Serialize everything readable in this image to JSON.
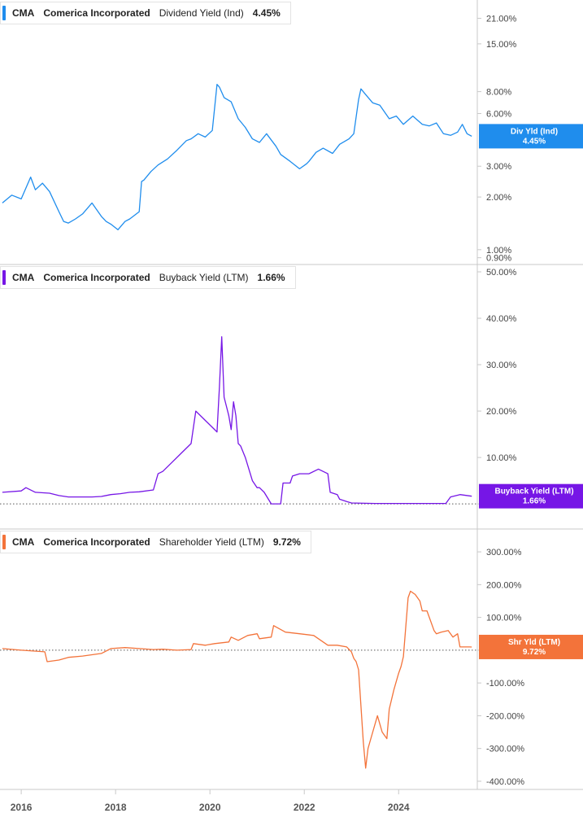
{
  "chart_data": [
    {
      "type": "line",
      "ticker": "CMA",
      "company": "Comerica Incorporated",
      "metric": "Dividend Yield (Ind)",
      "value_label": "4.45%",
      "badge_title": "Div Yld (Ind)",
      "badge_value": "4.45%",
      "color": "#1f8ded",
      "yscale": "log",
      "ylim": [
        0.85,
        24
      ],
      "ytick_values": [
        21,
        15,
        8,
        6,
        3,
        2,
        1,
        0.9
      ],
      "ytick_labels": [
        "21.00%",
        "15.00%",
        "8.00%",
        "6.00%",
        "3.00%",
        "2.00%",
        "1.00%",
        "0.90%"
      ],
      "x": [
        2015.6,
        2015.8,
        2016.0,
        2016.2,
        2016.3,
        2016.45,
        2016.6,
        2016.8,
        2016.9,
        2017.0,
        2017.15,
        2017.3,
        2017.5,
        2017.7,
        2017.8,
        2017.9,
        2018.05,
        2018.2,
        2018.3,
        2018.5,
        2018.55,
        2018.6,
        2018.75,
        2018.9,
        2019.1,
        2019.3,
        2019.5,
        2019.6,
        2019.75,
        2019.9,
        2020.05,
        2020.15,
        2020.2,
        2020.3,
        2020.45,
        2020.6,
        2020.75,
        2020.9,
        2021.05,
        2021.2,
        2021.4,
        2021.5,
        2021.7,
        2021.9,
        2022.05,
        2022.1,
        2022.25,
        2022.4,
        2022.6,
        2022.75,
        2022.95,
        2023.05,
        2023.15,
        2023.2,
        2023.3,
        2023.45,
        2023.6,
        2023.8,
        2023.95,
        2024.1,
        2024.3,
        2024.5,
        2024.65,
        2024.8,
        2024.95,
        2025.1,
        2025.25,
        2025.35,
        2025.45,
        2025.55
      ],
      "y": [
        1.85,
        2.05,
        1.95,
        2.6,
        2.2,
        2.4,
        2.15,
        1.65,
        1.45,
        1.42,
        1.5,
        1.6,
        1.85,
        1.55,
        1.45,
        1.4,
        1.3,
        1.45,
        1.5,
        1.65,
        2.45,
        2.5,
        2.8,
        3.05,
        3.3,
        3.7,
        4.2,
        4.3,
        4.6,
        4.4,
        4.8,
        8.8,
        8.5,
        7.4,
        7.0,
        5.6,
        5.0,
        4.3,
        4.1,
        4.6,
        3.9,
        3.5,
        3.2,
        2.9,
        3.1,
        3.2,
        3.6,
        3.8,
        3.55,
        4.0,
        4.3,
        4.6,
        7.2,
        8.3,
        7.7,
        6.9,
        6.7,
        5.6,
        5.8,
        5.2,
        5.8,
        5.2,
        5.1,
        5.3,
        4.6,
        4.5,
        4.7,
        5.2,
        4.6,
        4.45
      ]
    },
    {
      "type": "line",
      "ticker": "CMA",
      "company": "Comerica Incorporated",
      "metric": "Buyback Yield (LTM)",
      "value_label": "1.66%",
      "badge_title": "Buyback Yield (LTM)",
      "badge_value": "1.66%",
      "color": "#7616e6",
      "yscale": "linear",
      "ylim": [
        -0.5,
        50
      ],
      "ytick_values": [
        50,
        40,
        30,
        20,
        10,
        0
      ],
      "ytick_labels": [
        "50.00%",
        "40.00%",
        "30.00%",
        "20.00%",
        "10.00%",
        "0.00%"
      ],
      "x": [
        2015.6,
        2016.0,
        2016.1,
        2016.3,
        2016.6,
        2016.8,
        2017.0,
        2017.3,
        2017.5,
        2017.7,
        2017.9,
        2018.1,
        2018.3,
        2018.5,
        2018.8,
        2018.9,
        2019.0,
        2019.2,
        2019.4,
        2019.6,
        2019.7,
        2019.9,
        2020.1,
        2020.15,
        2020.2,
        2020.25,
        2020.3,
        2020.35,
        2020.4,
        2020.45,
        2020.5,
        2020.55,
        2020.6,
        2020.65,
        2020.75,
        2020.9,
        2021.0,
        2021.05,
        2021.15,
        2021.3,
        2021.3,
        2021.5,
        2021.55,
        2021.7,
        2021.75,
        2021.9,
        2022.1,
        2022.3,
        2022.5,
        2022.55,
        2022.7,
        2022.75,
        2022.9,
        2023.0,
        2023.5,
        2024.0,
        2024.5,
        2025.0,
        2025.1,
        2025.3,
        2025.55
      ],
      "y": [
        2.5,
        2.8,
        3.5,
        2.5,
        2.3,
        1.8,
        1.5,
        1.5,
        1.5,
        1.6,
        2.0,
        2.2,
        2.5,
        2.6,
        3.0,
        6.5,
        7.0,
        9.0,
        11.0,
        13.0,
        20.0,
        18.0,
        16.0,
        15.5,
        25.0,
        36.0,
        23.0,
        21.0,
        19.0,
        16.0,
        22.0,
        19.0,
        13.0,
        12.5,
        10.0,
        5.0,
        3.5,
        3.5,
        2.5,
        0,
        0,
        0,
        4.5,
        4.5,
        6.0,
        6.5,
        6.5,
        7.5,
        6.5,
        2.5,
        2.0,
        1.0,
        0.5,
        0.2,
        0.1,
        0.1,
        0.1,
        0.1,
        1.5,
        2.0,
        1.66
      ]
    },
    {
      "type": "line",
      "ticker": "CMA",
      "company": "Comerica Incorporated",
      "metric": "Shareholder Yield (LTM)",
      "value_label": "9.72%",
      "badge_title": "Shr Yld (LTM)",
      "badge_value": "9.72%",
      "color": "#f3733a",
      "yscale": "linear",
      "ylim": [
        -420,
        330
      ],
      "ytick_values": [
        300,
        200,
        100,
        0,
        -100,
        -200,
        -300,
        -400
      ],
      "ytick_labels": [
        "300.00%",
        "200.00%",
        "100.00%",
        "0.00%",
        "-100.00%",
        "-200.00%",
        "-300.00%",
        "-400.00%"
      ],
      "x": [
        2015.6,
        2016.0,
        2016.5,
        2016.55,
        2016.8,
        2017.0,
        2017.3,
        2017.7,
        2017.9,
        2018.2,
        2018.5,
        2018.8,
        2019.0,
        2019.3,
        2019.6,
        2019.65,
        2019.9,
        2020.1,
        2020.4,
        2020.45,
        2020.6,
        2020.8,
        2021.0,
        2021.05,
        2021.3,
        2021.35,
        2021.6,
        2021.9,
        2022.2,
        2022.5,
        2022.7,
        2022.9,
        2023.0,
        2023.05,
        2023.1,
        2023.15,
        2023.25,
        2023.3,
        2023.35,
        2023.45,
        2023.55,
        2023.65,
        2023.75,
        2023.8,
        2023.9,
        2024.0,
        2024.05,
        2024.1,
        2024.2,
        2024.25,
        2024.35,
        2024.45,
        2024.5,
        2024.6,
        2024.75,
        2024.8,
        2024.9,
        2025.05,
        2025.15,
        2025.25,
        2025.3,
        2025.5,
        2025.55
      ],
      "y": [
        5,
        0,
        -5,
        -35,
        -30,
        -22,
        -18,
        -10,
        5,
        8,
        5,
        2,
        3,
        0,
        2,
        20,
        15,
        20,
        25,
        40,
        30,
        45,
        50,
        35,
        40,
        75,
        55,
        50,
        45,
        15,
        15,
        10,
        -5,
        -25,
        -35,
        -60,
        -280,
        -360,
        -300,
        -250,
        -200,
        -250,
        -270,
        -180,
        -120,
        -70,
        -50,
        -20,
        160,
        180,
        170,
        150,
        120,
        120,
        60,
        50,
        55,
        60,
        40,
        50,
        10,
        10,
        9.72
      ]
    }
  ],
  "x_axis": {
    "tick_values": [
      2016,
      2018,
      2020,
      2022,
      2024
    ],
    "tick_labels": [
      "2016",
      "2018",
      "2020",
      "2022",
      "2024"
    ],
    "xlim": [
      2015.55,
      2025.65
    ]
  }
}
